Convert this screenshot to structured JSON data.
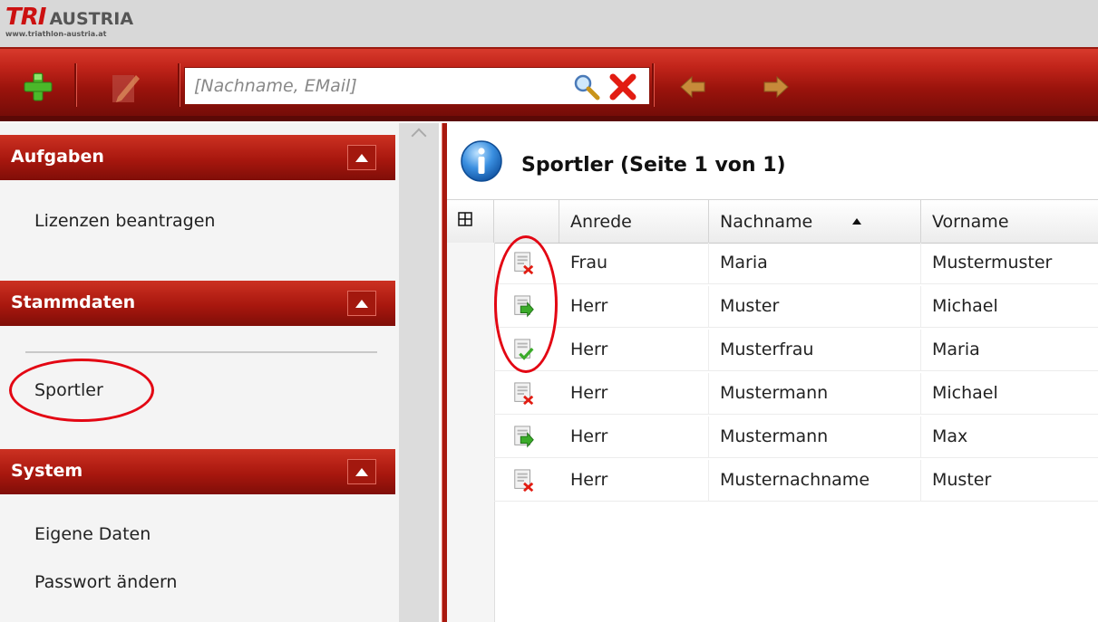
{
  "logo": {
    "brand_tri": "TRI",
    "brand_austria": "AUSTRIA",
    "url": "www.triathlon-austria.at"
  },
  "toolbar": {
    "search_placeholder": "[Nachname, EMail]",
    "icons": [
      "add-icon",
      "edit-icon",
      "search-icon",
      "clear-icon",
      "back-arrow-icon",
      "forward-arrow-icon"
    ]
  },
  "sidebar": {
    "sections": [
      {
        "title": "Aufgaben",
        "items": [
          "Lizenzen beantragen"
        ]
      },
      {
        "title": "Stammdaten",
        "items": [
          "Sportler"
        ]
      },
      {
        "title": "System",
        "items": [
          "Eigene Daten",
          "Passwort ändern"
        ]
      }
    ]
  },
  "main": {
    "title": "Sportler (Seite 1 von 1)",
    "columns": [
      "Anrede",
      "Nachname",
      "Vorname"
    ],
    "sort_column": "Nachname",
    "sort_direction": "asc",
    "rows": [
      {
        "status": "rejected",
        "anrede": "Frau",
        "nachname": "Maria",
        "vorname": "Mustermuster"
      },
      {
        "status": "forwarded",
        "anrede": "Herr",
        "nachname": "Muster",
        "vorname": "Michael"
      },
      {
        "status": "approved",
        "anrede": "Herr",
        "nachname": "Musterfrau",
        "vorname": "Maria"
      },
      {
        "status": "rejected",
        "anrede": "Herr",
        "nachname": "Mustermann",
        "vorname": "Michael"
      },
      {
        "status": "forwarded",
        "anrede": "Herr",
        "nachname": "Mustermann",
        "vorname": "Max"
      },
      {
        "status": "rejected",
        "anrede": "Herr",
        "nachname": "Musternachname",
        "vorname": "Muster"
      }
    ]
  },
  "colors": {
    "accent_red": "#b81d12",
    "annotation_red": "#e30613"
  }
}
